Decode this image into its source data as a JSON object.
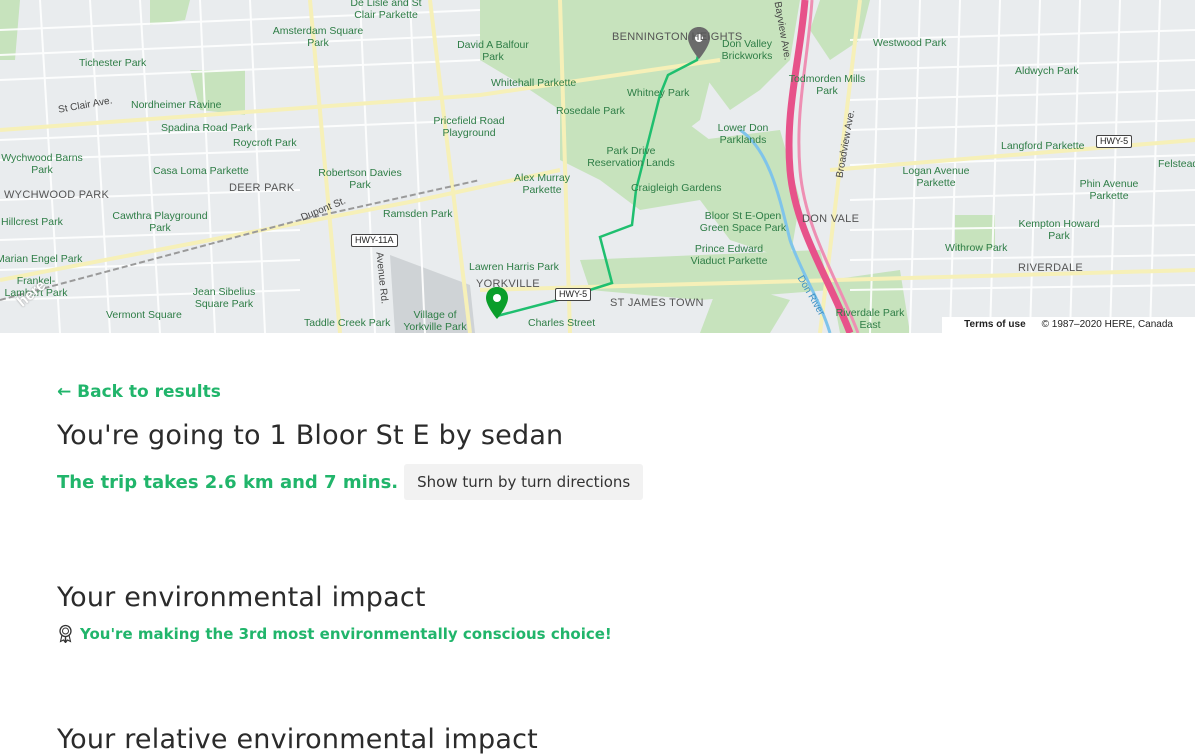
{
  "map": {
    "areas": [
      "BENNINGTON HEIGHTS",
      "WYCHWOOD PARK",
      "DEER PARK",
      "YORKVILLE",
      "ST JAMES TOWN",
      "DON VALE",
      "RIVERDALE"
    ],
    "parks": [
      "Amsterdam Square Park",
      "David A Balfour Park",
      "Tichester Park",
      "Westwood Park",
      "Don Valley Brickworks",
      "Aldwych Park",
      "Todmorden Mills Park",
      "Nordheimer Ravine",
      "Whitehall Parkette",
      "Whitney Park",
      "Spadina Road Park",
      "Rosedale Park",
      "Roycroft Park",
      "Pricefield Road Playground",
      "Lower Don Parklands",
      "Wychwood Barns Park",
      "Casa Loma Parkette",
      "Park Drive Reservation Lands",
      "Langford Parkette",
      "Robertson Davies Park",
      "Alex Murray Parkette",
      "Logan Avenue Parkette",
      "Craigleigh Gardens",
      "Phin Avenue Parkette",
      "Hillcrest Park",
      "Cawthra Playground Park",
      "Ramsden Park",
      "Bloor St E-Open Green Space Park",
      "Kempton Howard Park",
      "Marian Engel Park",
      "Prince Edward Viaduct Parkette",
      "Withrow Park",
      "Lawren Harris Park",
      "Jean Sibelius Square Park",
      "Frankel-Lambert Park",
      "Vermont Square",
      "Taddle Creek Park",
      "Village of Yorkville Park",
      "Charles Street",
      "Riverdale Park East",
      "De Lisle and St Clair Parkette",
      "Felstead"
    ],
    "streets": [
      "St Clair Ave.",
      "Dupont St.",
      "Avenue Rd.",
      "Bayview Ave.",
      "Broadview Ave.",
      "Don River"
    ],
    "shields": [
      "HWY-11A",
      "HWY-5",
      "HWY-5"
    ],
    "brand": "here",
    "attribution": {
      "terms": "Terms of use",
      "copyright": "© 1987–2020 HERE, Canada"
    },
    "route_color": "#1fbf6f",
    "destination_pin_color": "#6b6b6b",
    "origin_pin_color": "#0a9e2a"
  },
  "page": {
    "back_label": "← Back to results",
    "destination_heading": "You're going to 1 Bloor St E by sedan",
    "trip_summary": "The trip takes 2.6 km and 7 mins.",
    "turn_button": "Show turn by turn directions",
    "impact_heading": "Your environmental impact",
    "impact_icon": "medal-icon",
    "impact_message": "You're making the 3rd most environmentally conscious choice!",
    "relative_heading": "Your relative environmental impact",
    "accent_color": "#21b56b"
  }
}
